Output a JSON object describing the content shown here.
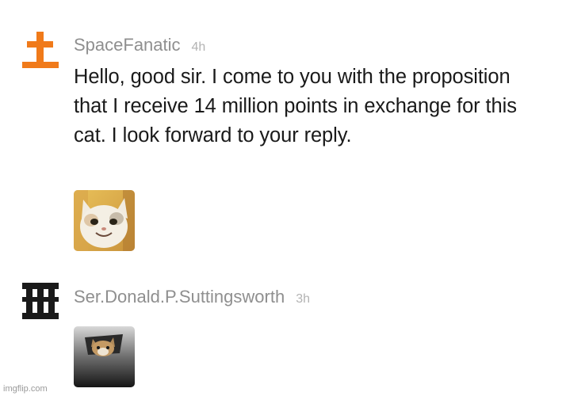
{
  "comments": [
    {
      "username": "SpaceFanatic",
      "time": "4h",
      "text": "Hello, good sir. I come to you with the proposition that I receive 14 million points in exchange for this cat. I look forward to your reply.",
      "avatar_icon": "cross-avatar-icon",
      "avatar_color": "#f07a1a",
      "attachment": "smiling-cat-image"
    },
    {
      "username": "Ser.Donald.P.Suttingsworth",
      "time": "3h",
      "avatar_icon": "pillars-avatar-icon",
      "avatar_color": "#1a1a1a",
      "attachment": "ceiling-cat-image"
    }
  ],
  "watermark": "imgflip.com"
}
